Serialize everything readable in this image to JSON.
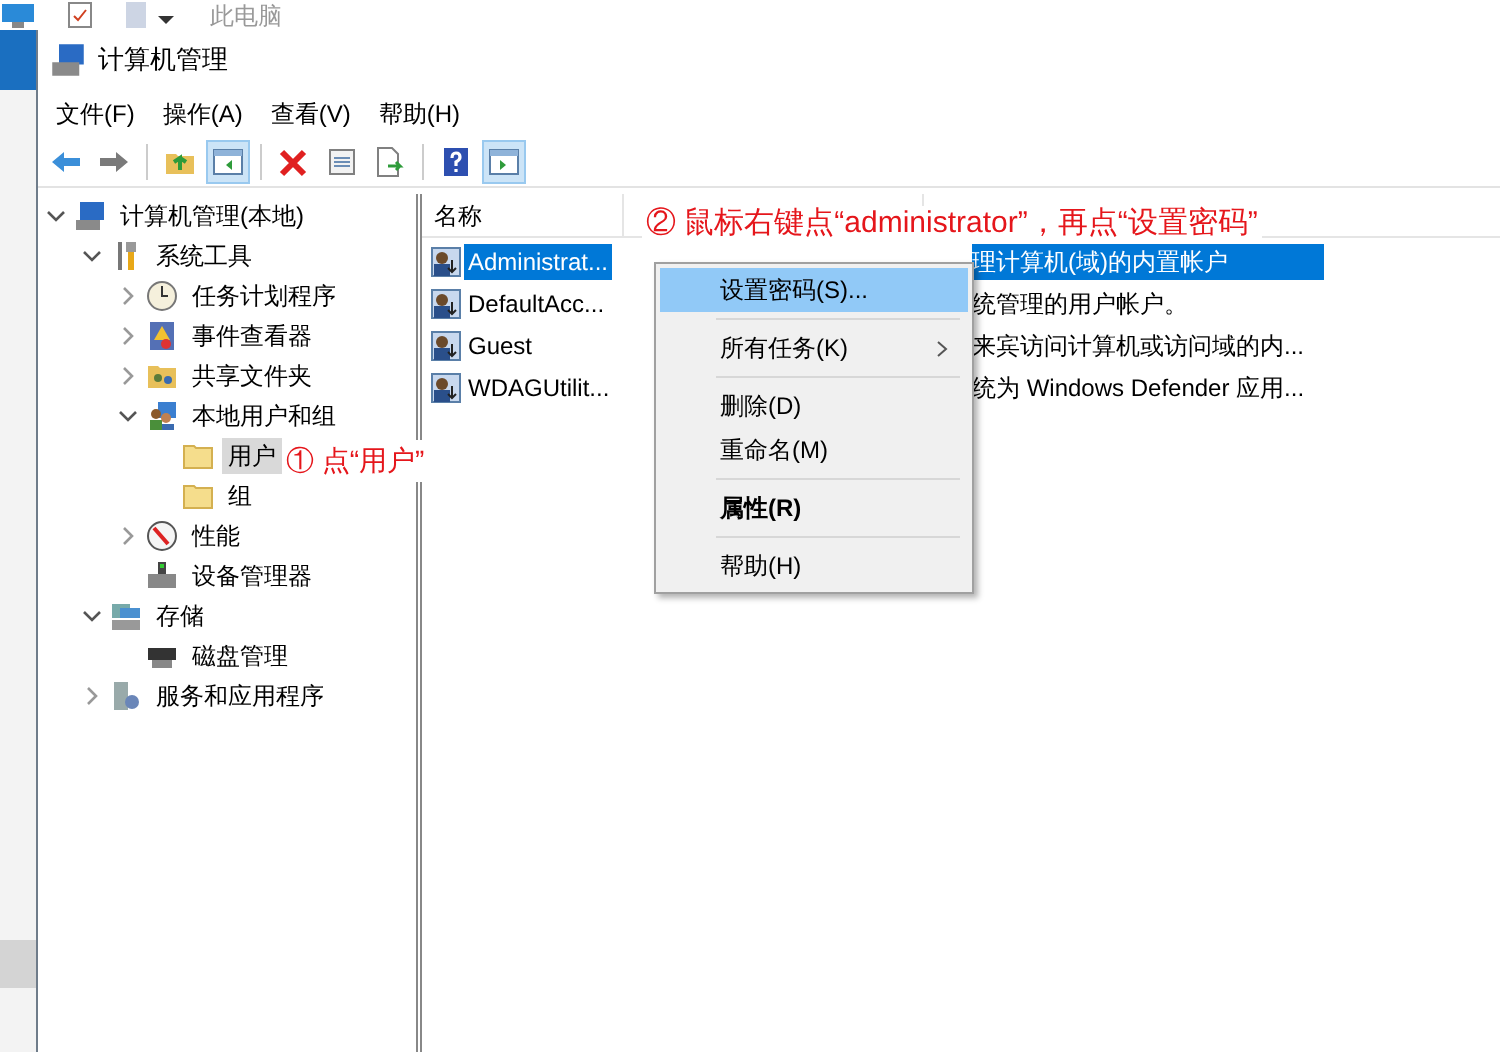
{
  "background_window": {
    "title": "此电脑"
  },
  "window": {
    "title": "计算机管理"
  },
  "menu": [
    "文件(F)",
    "操作(A)",
    "查看(V)",
    "帮助(H)"
  ],
  "toolbar": [
    {
      "kind": "back",
      "pressed": false
    },
    {
      "kind": "forward",
      "pressed": false
    },
    {
      "kind": "separator"
    },
    {
      "kind": "up",
      "pressed": false
    },
    {
      "kind": "tree",
      "pressed": true
    },
    {
      "kind": "separator"
    },
    {
      "kind": "delete",
      "pressed": false
    },
    {
      "kind": "properties",
      "pressed": false
    },
    {
      "kind": "export",
      "pressed": false
    },
    {
      "kind": "separator"
    },
    {
      "kind": "help",
      "pressed": false
    },
    {
      "kind": "action",
      "pressed": true
    }
  ],
  "tree": [
    {
      "label": "计算机管理(本地)",
      "kind": "computer",
      "expanded": true,
      "selected": false,
      "children": [
        {
          "label": "系统工具",
          "kind": "tools",
          "expanded": true,
          "selected": false,
          "children": [
            {
              "label": "任务计划程序",
              "kind": "clock",
              "expanded": false,
              "selected": false
            },
            {
              "label": "事件查看器",
              "kind": "log",
              "expanded": false,
              "selected": false
            },
            {
              "label": "共享文件夹",
              "kind": "share",
              "expanded": false,
              "selected": false
            },
            {
              "label": "本地用户和组",
              "kind": "users",
              "expanded": true,
              "selected": false,
              "children": [
                {
                  "label": "用户",
                  "kind": "folder",
                  "selected": true
                },
                {
                  "label": "组",
                  "kind": "folder",
                  "selected": false
                }
              ]
            },
            {
              "label": "性能",
              "kind": "perf",
              "expanded": false,
              "selected": false
            },
            {
              "label": "设备管理器",
              "kind": "device",
              "selected": false
            }
          ]
        },
        {
          "label": "存储",
          "kind": "storage",
          "expanded": true,
          "selected": false,
          "children": [
            {
              "label": "磁盘管理",
              "kind": "disk",
              "selected": false
            }
          ]
        },
        {
          "label": "服务和应用程序",
          "kind": "services",
          "expanded": false,
          "selected": false
        }
      ]
    }
  ],
  "list": {
    "columns": [
      "名称"
    ],
    "rows": [
      {
        "name": "Administrat...",
        "description": "理计算机(域)的内置帐户",
        "selected": true
      },
      {
        "name": "DefaultAcc...",
        "description": "统管理的用户帐户。",
        "selected": false
      },
      {
        "name": "Guest",
        "description": "来宾访问计算机或访问域的内...",
        "selected": false
      },
      {
        "name": "WDAGUtilit...",
        "description": "统为 Windows Defender 应用...",
        "selected": false
      }
    ]
  },
  "context_menu": [
    {
      "kind": "item",
      "label": "设置密码(S)...",
      "highlighted": true,
      "default": false
    },
    {
      "kind": "separator"
    },
    {
      "kind": "submenu",
      "label": "所有任务(K)",
      "highlighted": false,
      "default": false
    },
    {
      "kind": "separator"
    },
    {
      "kind": "item",
      "label": "删除(D)",
      "highlighted": false,
      "default": false
    },
    {
      "kind": "item",
      "label": "重命名(M)",
      "highlighted": false,
      "default": false
    },
    {
      "kind": "separator"
    },
    {
      "kind": "item",
      "label": "属性(R)",
      "highlighted": false,
      "default": true
    },
    {
      "kind": "separator"
    },
    {
      "kind": "item",
      "label": "帮助(H)",
      "highlighted": false,
      "default": false
    }
  ],
  "annotations": [
    {
      "label": "① 点“用户”"
    },
    {
      "label": "② 鼠标右键点“administrator”，再点“设置密码”"
    }
  ]
}
